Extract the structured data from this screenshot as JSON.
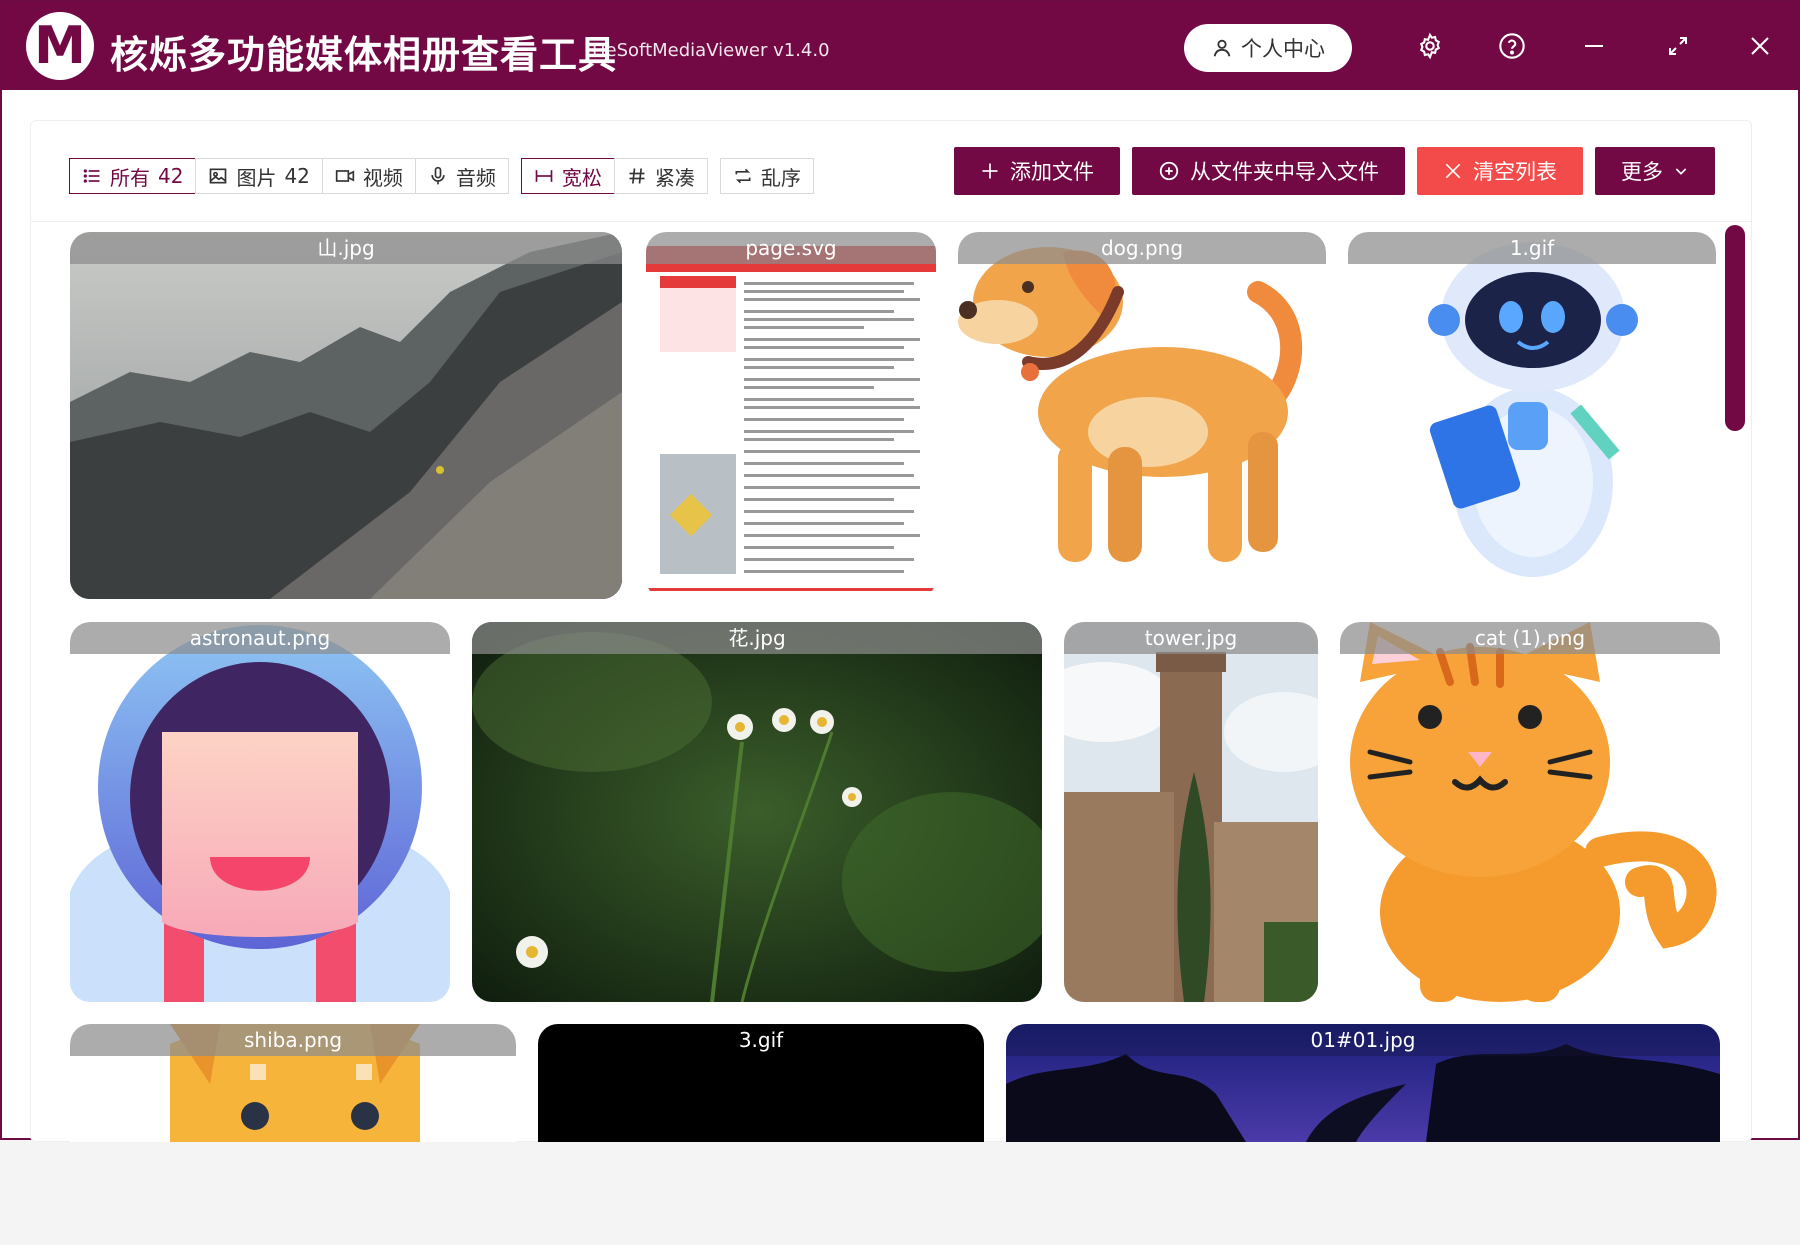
{
  "app": {
    "logo_letter": "M",
    "title": "核烁多功能媒体相册查看工具",
    "version": "HeSoftMediaViewer v1.4.0",
    "user_center": "个人中心"
  },
  "filters": {
    "all_label": "所有",
    "all_count": "42",
    "image_label": "图片",
    "image_count": "42",
    "video_label": "视频",
    "audio_label": "音频",
    "loose_label": "宽松",
    "compact_label": "紧凑",
    "shuffle_label": "乱序"
  },
  "actions": {
    "add_files": "添加文件",
    "import_folder": "从文件夹中导入文件",
    "clear_list": "清空列表",
    "more": "更多"
  },
  "media": [
    {
      "name": "山.jpg"
    },
    {
      "name": "page.svg"
    },
    {
      "name": "dog.png"
    },
    {
      "name": "1.gif"
    },
    {
      "name": "astronaut.png"
    },
    {
      "name": "花.jpg"
    },
    {
      "name": "tower.jpg"
    },
    {
      "name": "cat (1).png"
    },
    {
      "name": "shiba.png"
    },
    {
      "name": "3.gif"
    },
    {
      "name": "01#01.jpg"
    }
  ],
  "colors": {
    "brand": "#720944",
    "danger": "#f34a4a"
  }
}
